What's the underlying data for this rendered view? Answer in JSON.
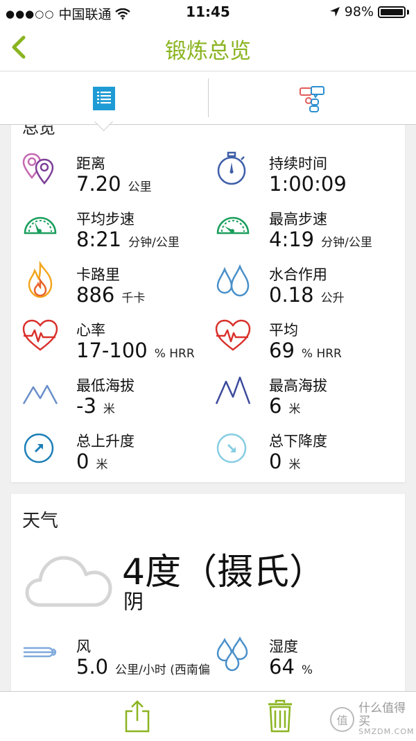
{
  "status_bar": {
    "carrier": "中国联通",
    "time": "11:45",
    "battery": "98%"
  },
  "nav": {
    "title": "锻炼总览"
  },
  "summary_card": {
    "partial_title": "总览",
    "metrics": [
      {
        "label": "距离",
        "value": "7.20",
        "unit": "公里",
        "icon": "location-pins-icon"
      },
      {
        "label": "持续时间",
        "value": "1:00:09",
        "unit": "",
        "icon": "stopwatch-icon"
      },
      {
        "label": "平均步速",
        "value": "8:21",
        "unit": "分钟/公里",
        "icon": "speedometer-icon"
      },
      {
        "label": "最高步速",
        "value": "4:19",
        "unit": "分钟/公里",
        "icon": "speedometer-icon"
      },
      {
        "label": "卡路里",
        "value": "886",
        "unit": "千卡",
        "icon": "flame-icon"
      },
      {
        "label": "水合作用",
        "value": "0.18",
        "unit": "公升",
        "icon": "water-drops-icon"
      },
      {
        "label": "心率",
        "value": "17-100",
        "unit": "% HRR",
        "icon": "heart-rate-icon"
      },
      {
        "label": "平均",
        "value": "69",
        "unit": "% HRR",
        "icon": "heart-rate-icon"
      },
      {
        "label": "最低海拔",
        "value": "-3",
        "unit": "米",
        "icon": "mountain-icon"
      },
      {
        "label": "最高海拔",
        "value": "6",
        "unit": "米",
        "icon": "mountain-icon"
      },
      {
        "label": "总上升度",
        "value": "0",
        "unit": "米",
        "icon": "ascent-arrow-icon"
      },
      {
        "label": "总下降度",
        "value": "0",
        "unit": "米",
        "icon": "descent-arrow-icon"
      }
    ]
  },
  "weather_card": {
    "title": "天气",
    "temperature": "4度（摄氏）",
    "condition": "阴",
    "wind": {
      "label": "风",
      "value": "5.0",
      "unit": "公里/小时 (西南偏"
    },
    "humidity": {
      "label": "湿度",
      "value": "64",
      "unit": "%"
    }
  },
  "watermark": {
    "logo": "值",
    "text_cn": "什么值得买",
    "text_en": "SMZDM.COM"
  },
  "colors": {
    "accent_green": "#8ab420",
    "tab_blue": "#1e9bd4"
  }
}
